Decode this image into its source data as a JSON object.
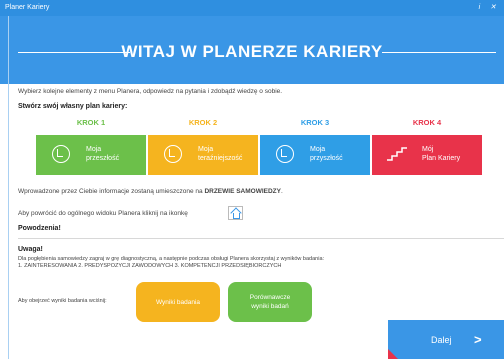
{
  "window": {
    "title": "Planer Kariery",
    "icons": "i ✕"
  },
  "banner": {
    "title": "WITAJ W PLANERZE KARIERY"
  },
  "intro": "Wybierz kolejne elementy z menu Planera, odpowiedz na pytania i zdobądź wiedzę o sobie.",
  "plan_heading": "Stwórz swój własny plan kariery:",
  "steps": [
    {
      "step": "KROK 1",
      "line1": "Moja",
      "line2": "przeszłość",
      "color": "#6cc04a",
      "icon": "clock-check-icon"
    },
    {
      "step": "KROK 2",
      "line1": "Moja",
      "line2": "teraźniejszość",
      "color": "#f5b41f",
      "icon": "clock-check-icon"
    },
    {
      "step": "KROK 3",
      "line1": "Moja",
      "line2": "przyszłość",
      "color": "#2f9ee6",
      "icon": "clock-check-icon"
    },
    {
      "step": "KROK 4",
      "line1": "Mój",
      "line2": "Plan Kariery",
      "color": "#e8334a",
      "icon": "stairs-icon"
    }
  ],
  "tree_info_prefix": "Wprowadzone przez Ciebie informacje zostaną umieszczone na ",
  "tree_info_bold": "DRZEWIE SAMOWIEDZY",
  "tree_info_suffix": ".",
  "home_info": "Aby powrócić do ogólnego widoku Planera kliknij na ikonkę",
  "good_luck": "Powodzenia!",
  "note": {
    "title": "Uwaga!",
    "line1": "Dla pogłębienia samowiedzy zagraj w grę diagnostyczną, a następnie podczas obsługi Planera skorzystaj z wyników badania:",
    "line2": "1. ZAINTERESOWANIA    2. PREDYSPOZYCJI ZAWODOWYCH    3. KOMPETENCJI PRZEDSIĘBIORCZYCH"
  },
  "results": {
    "prompt": "Aby obejrzeć wyniki badania wciśnij:",
    "button1": "Wyniki badania",
    "button2_line1": "Porównawcze",
    "button2_line2": "wyniki badań",
    "button1_color": "#f5b41f",
    "button2_color": "#6cc04a"
  },
  "next": {
    "label": "Dalej",
    "chevron": ">"
  },
  "colors": {
    "titlebar": "#2f8fe0",
    "banner": "#3a96e6",
    "accent_red": "#e8334a"
  }
}
